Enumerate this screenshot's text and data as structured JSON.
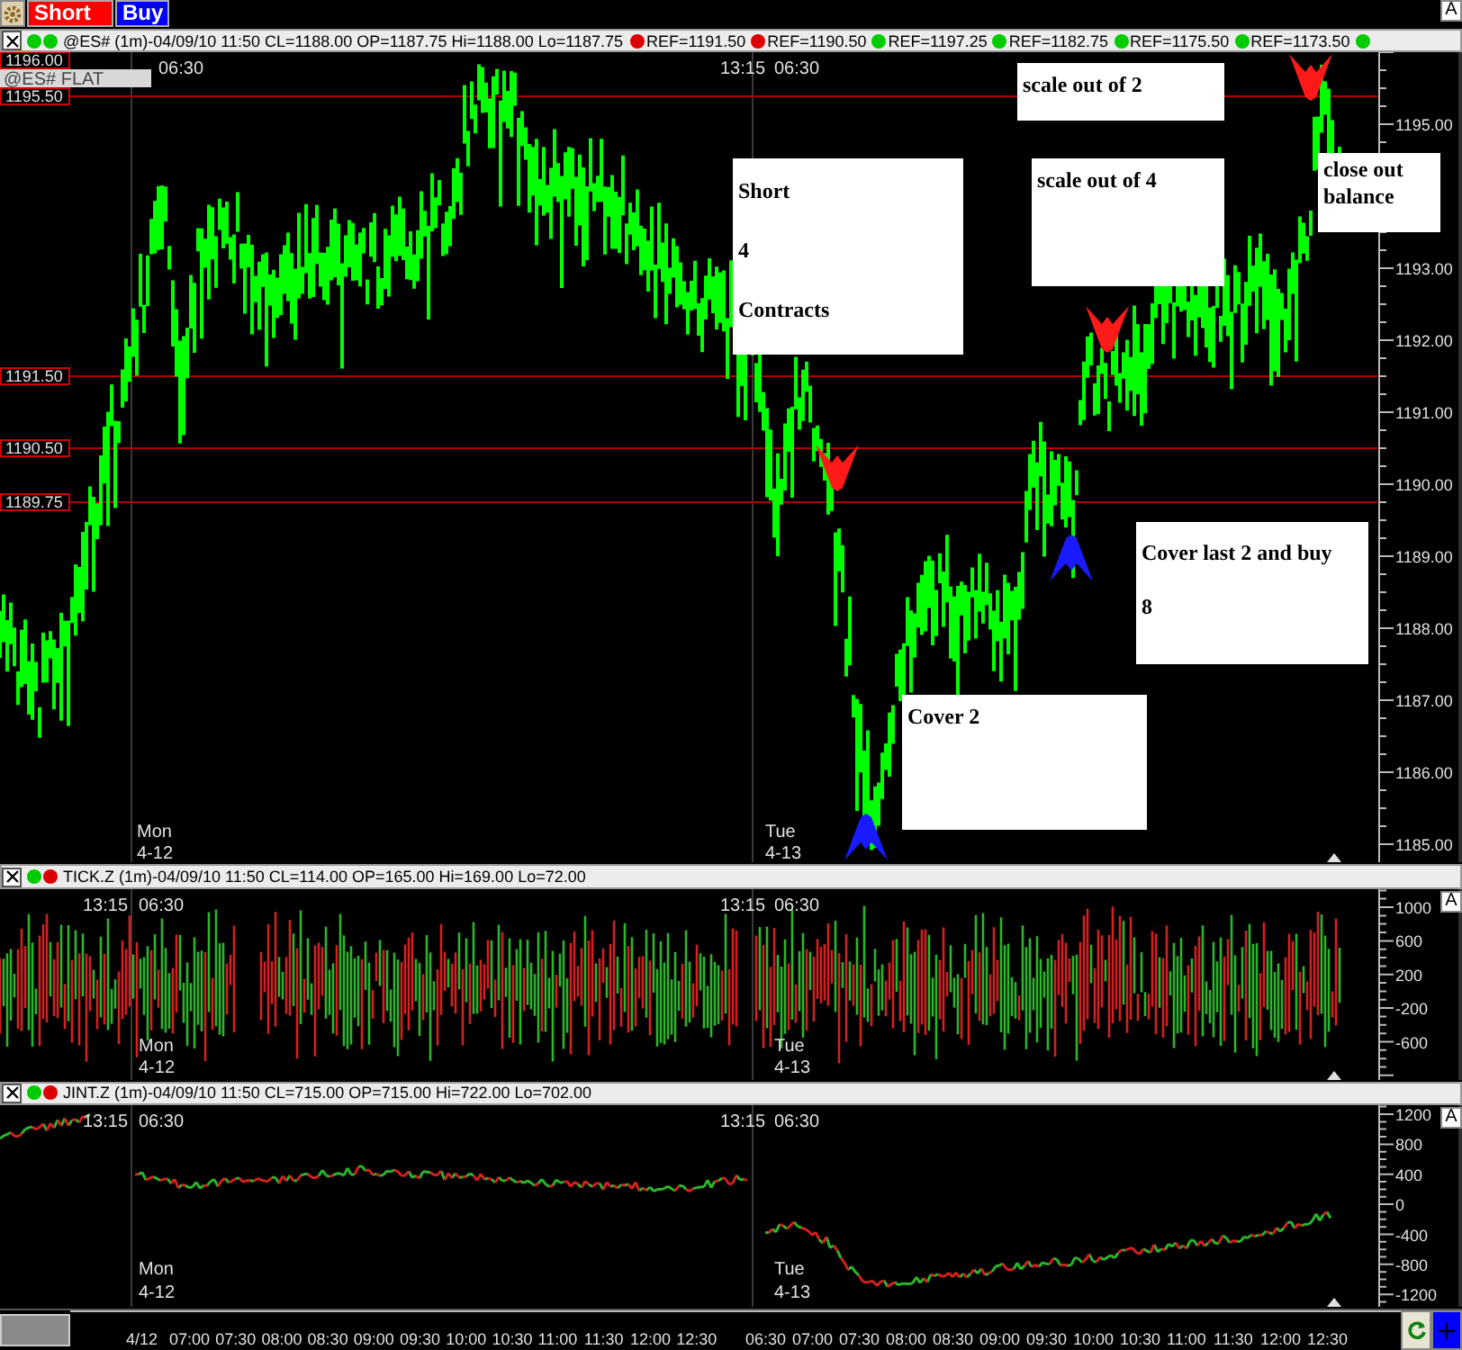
{
  "toolbar": {
    "buttons": [
      {
        "kind": "settings"
      },
      {
        "kind": "short",
        "label": "Short"
      },
      {
        "kind": "buy",
        "label": "Buy"
      }
    ],
    "autoscale": "A"
  },
  "panes": [
    {
      "kind": "price",
      "status_dots": [
        {
          "color": "#00cc00"
        },
        {
          "color": "#00cc00"
        }
      ],
      "title": "@ES# (1m)-04/09/10 11:50 CL=1188.00 OP=1187.75 Hi=1188.00 Lo=1187.75",
      "refs": [
        {
          "label": "REF=1191.50",
          "color": "#dd0000"
        },
        {
          "label": "REF=1190.50",
          "color": "#dd0000"
        },
        {
          "label": "REF=1197.25",
          "color": "#00cc00"
        },
        {
          "label": "REF=1182.75",
          "color": "#00cc00"
        },
        {
          "label": "REF=1175.50",
          "color": "#00cc00"
        },
        {
          "label": "REF=1173.50",
          "color": "#00cc00"
        },
        {
          "color": "#00cc00"
        }
      ],
      "symbol_label": "@ES# FLAT",
      "price_lines": [
        {
          "label": "1196.00"
        },
        {
          "label": "1195.50"
        },
        {
          "label": "1191.50"
        },
        {
          "label": "1190.50"
        },
        {
          "label": "1189.75"
        }
      ],
      "time_labels": [
        "06:30",
        "13:15",
        "06:30"
      ],
      "day_labels": [
        {
          "day": "Mon",
          "date": "4-12"
        },
        {
          "day": "Tue",
          "date": "4-13"
        }
      ],
      "axis_labels": [
        "1195.00",
        "1193.00",
        "1192.00",
        "1191.00",
        "1190.00",
        "1189.00",
        "1188.00",
        "1187.00",
        "1186.00",
        "1185.00"
      ],
      "signals": [
        {
          "kind": "sell"
        },
        {
          "kind": "sell"
        },
        {
          "kind": "sell"
        },
        {
          "kind": "buy"
        },
        {
          "kind": "buy"
        }
      ],
      "annotations": [
        {
          "lines": [
            "Short",
            "4",
            "Contracts"
          ]
        },
        {
          "lines": [
            "scale out of 2"
          ]
        },
        {
          "lines": [
            "scale out of 4"
          ]
        },
        {
          "lines": [
            "close out",
            "balance"
          ]
        },
        {
          "lines": [
            "Cover last 2 and buy",
            "8"
          ]
        },
        {
          "lines": [
            "Cover 2"
          ]
        }
      ]
    },
    {
      "kind": "tick",
      "status_dots": [
        {
          "color": "#00cc00"
        },
        {
          "color": "#dd0000"
        }
      ],
      "title": "TICK.Z (1m)-04/09/10 11:50 CL=114.00 OP=165.00 Hi=169.00 Lo=72.00",
      "autoscale": "A",
      "time_labels": [
        "13:15",
        "06:30",
        "13:15",
        "06:30"
      ],
      "day_labels": [
        {
          "day": "Mon",
          "date": "4-12"
        },
        {
          "day": "Tue",
          "date": "4-13"
        }
      ],
      "axis_labels": [
        "1000",
        "600",
        "200",
        "-200",
        "-600"
      ]
    },
    {
      "kind": "jint",
      "status_dots": [
        {
          "color": "#00cc00"
        },
        {
          "color": "#dd0000"
        }
      ],
      "title": "JINT.Z (1m)-04/09/10 11:50 CL=715.00 OP=715.00 Hi=722.00 Lo=702.00",
      "autoscale": "A",
      "time_labels": [
        "13:15",
        "06:30",
        "13:15",
        "06:30"
      ],
      "day_labels": [
        {
          "day": "Mon",
          "date": "4-12"
        },
        {
          "day": "Tue",
          "date": "4-13"
        }
      ],
      "axis_labels": [
        "1200",
        "800",
        "400",
        "0",
        "-400",
        "-800",
        "-1200"
      ]
    }
  ],
  "time_axis": {
    "days": [
      {
        "labels": [
          "4/12",
          "07:00",
          "07:30",
          "08:00",
          "08:30",
          "09:00",
          "09:30",
          "10:00",
          "10:30",
          "11:00",
          "11:30",
          "12:00",
          "12:30"
        ]
      },
      {
        "labels": [
          "06:30",
          "07:00",
          "07:30",
          "08:00",
          "08:30",
          "09:00",
          "09:30",
          "10:00",
          "10:30",
          "11:00",
          "11:30",
          "12:00",
          "12:30"
        ]
      }
    ]
  }
}
